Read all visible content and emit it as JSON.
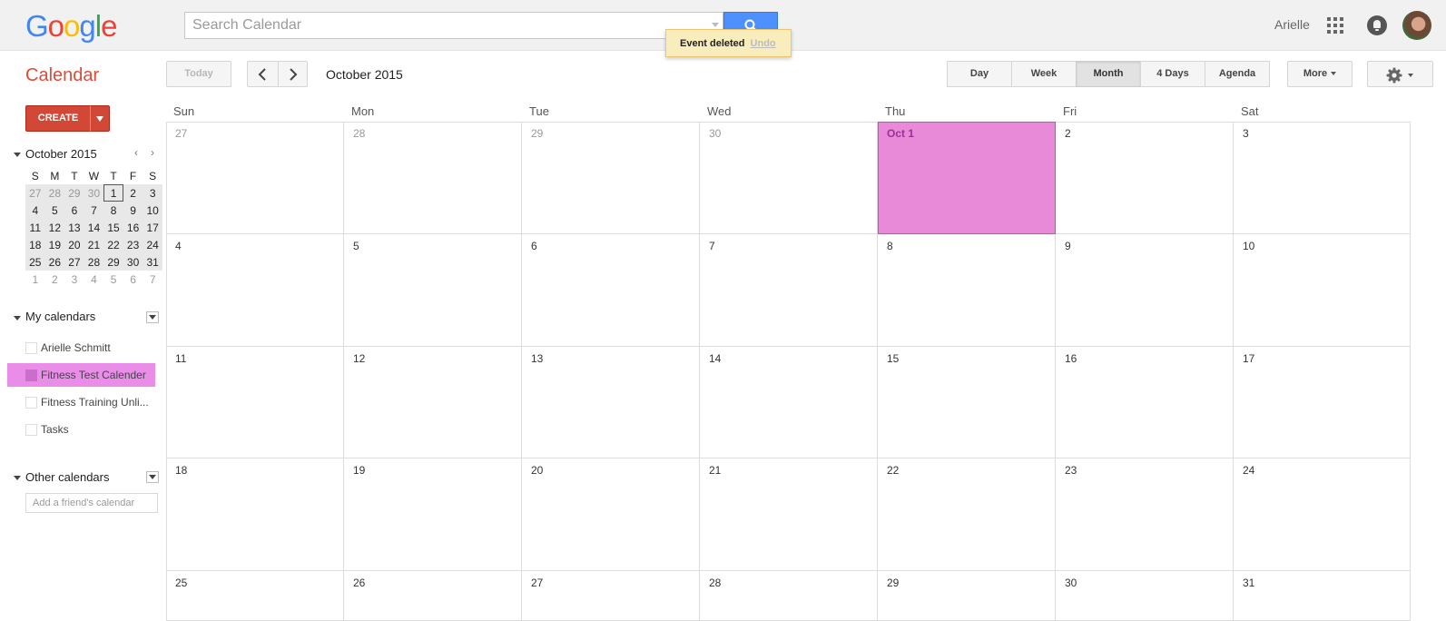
{
  "header": {
    "logo": "Google",
    "logo_colors": [
      "#4285f4",
      "#ea4335",
      "#fbbc05",
      "#4285f4",
      "#34a853",
      "#ea4335"
    ],
    "search_placeholder": "Search Calendar",
    "user_name": "Arielle"
  },
  "toast": {
    "message": "Event deleted",
    "undo": "Undo"
  },
  "toolbar": {
    "app_title": "Calendar",
    "today": "Today",
    "period": "October 2015",
    "views": [
      "Day",
      "Week",
      "Month",
      "4 Days",
      "Agenda"
    ],
    "active_view": "Month",
    "more": "More"
  },
  "sidebar": {
    "create": "CREATE",
    "mini_calendar": {
      "title": "October 2015",
      "weekday_headers": [
        "S",
        "M",
        "T",
        "W",
        "T",
        "F",
        "S"
      ],
      "weeks": [
        [
          "27",
          "28",
          "29",
          "30",
          "1",
          "2",
          "3"
        ],
        [
          "4",
          "5",
          "6",
          "7",
          "8",
          "9",
          "10"
        ],
        [
          "11",
          "12",
          "13",
          "14",
          "15",
          "16",
          "17"
        ],
        [
          "18",
          "19",
          "20",
          "21",
          "22",
          "23",
          "24"
        ],
        [
          "25",
          "26",
          "27",
          "28",
          "29",
          "30",
          "31"
        ],
        [
          "1",
          "2",
          "3",
          "4",
          "5",
          "6",
          "7"
        ]
      ],
      "today": "1"
    },
    "my_calendars": {
      "title": "My calendars",
      "items": [
        "Arielle Schmitt",
        "Fitness Test Calender",
        "Fitness Training Unli...",
        "Tasks"
      ],
      "highlighted": "Fitness Test Calender"
    },
    "other_calendars": {
      "title": "Other calendars",
      "add_placeholder": "Add a friend's calendar"
    }
  },
  "month_view": {
    "weekdays": [
      "Sun",
      "Mon",
      "Tue",
      "Wed",
      "Thu",
      "Fri",
      "Sat"
    ],
    "weeks": [
      [
        "27",
        "28",
        "29",
        "30",
        "Oct 1",
        "2",
        "3"
      ],
      [
        "4",
        "5",
        "6",
        "7",
        "8",
        "9",
        "10"
      ],
      [
        "11",
        "12",
        "13",
        "14",
        "15",
        "16",
        "17"
      ],
      [
        "18",
        "19",
        "20",
        "21",
        "22",
        "23",
        "24"
      ],
      [
        "25",
        "26",
        "27",
        "28",
        "29",
        "30",
        "31"
      ]
    ],
    "highlight_color": "#e98ad9"
  }
}
